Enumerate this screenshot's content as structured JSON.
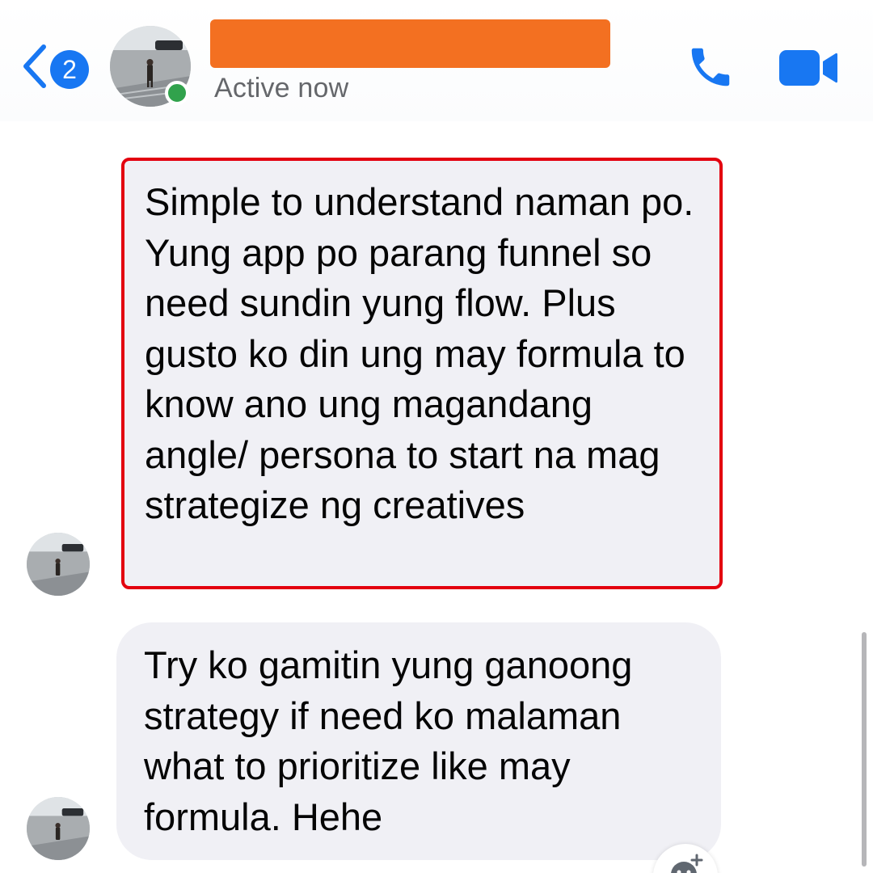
{
  "header": {
    "back_badge_count": "2",
    "status": "Active now",
    "name_redaction_color": "#f37021"
  },
  "messages": [
    {
      "text": "Simple to understand naman po. Yung app po parang funnel so need sundin yung flow. Plus gusto ko din ung may formula to know ano ung magandang angle/ persona to start na mag strategize ng creatives",
      "highlight_color": "#e3000f"
    },
    {
      "text": "Try ko gamitin yung ganoong strategy if need ko malaman what to prioritize like may formula. Hehe"
    }
  ],
  "icons": {
    "back": "chevron-left-icon",
    "call": "phone-icon",
    "video": "video-camera-icon",
    "reaction": "add-reaction-icon",
    "online": "online-status-dot"
  },
  "colors": {
    "accent": "#1877f2",
    "online": "#31a24c",
    "bubble_bg": "#f0f0f5",
    "secondary_text": "#65676b"
  }
}
